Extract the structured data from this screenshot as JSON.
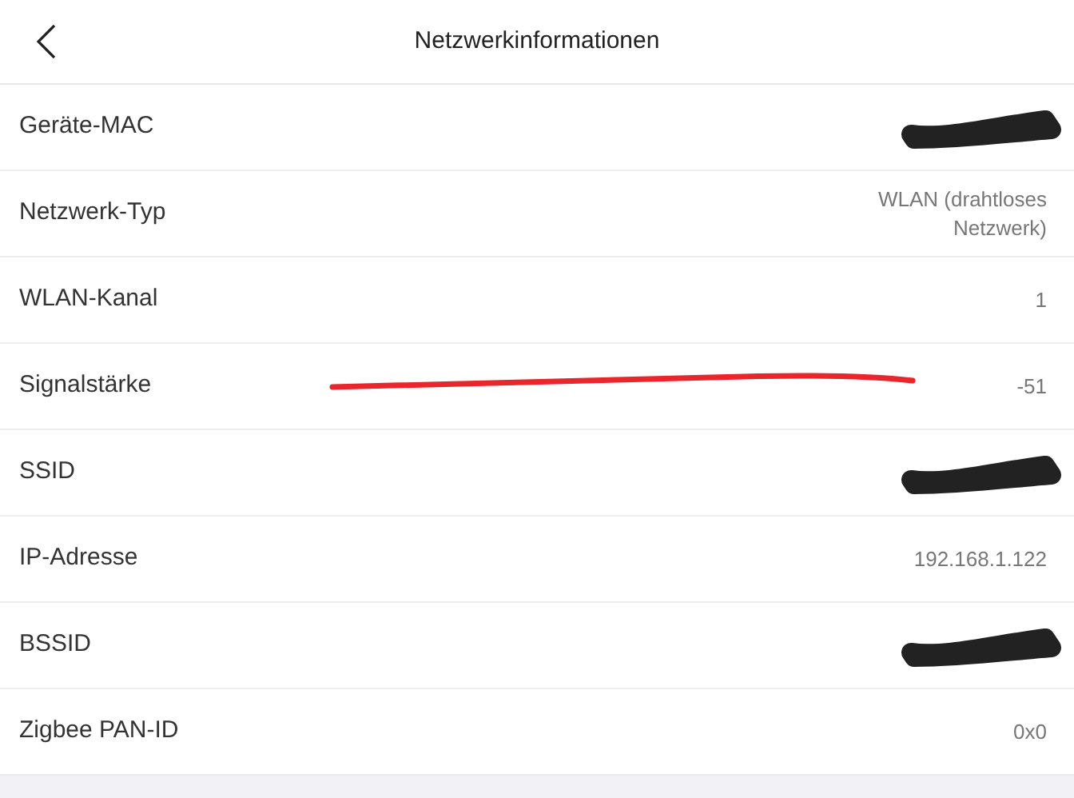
{
  "header": {
    "title": "Netzwerkinformationen"
  },
  "rows": [
    {
      "label": "Geräte-MAC",
      "redacted": true,
      "marked": false
    },
    {
      "label": "Netzwerk-Typ",
      "value": "WLAN (drahtloses Netzwerk)",
      "redacted": false,
      "marked": false
    },
    {
      "label": "WLAN-Kanal",
      "value": "1",
      "redacted": false,
      "marked": false
    },
    {
      "label": "Signalstärke",
      "value": "-51",
      "redacted": false,
      "marked": true
    },
    {
      "label": "SSID",
      "redacted": true,
      "marked": false
    },
    {
      "label": "IP-Adresse",
      "value": "192.168.1.122",
      "redacted": false,
      "marked": false
    },
    {
      "label": "BSSID",
      "redacted": true,
      "marked": false
    },
    {
      "label": "Zigbee PAN-ID",
      "value": "0x0",
      "redacted": false,
      "marked": false
    }
  ]
}
